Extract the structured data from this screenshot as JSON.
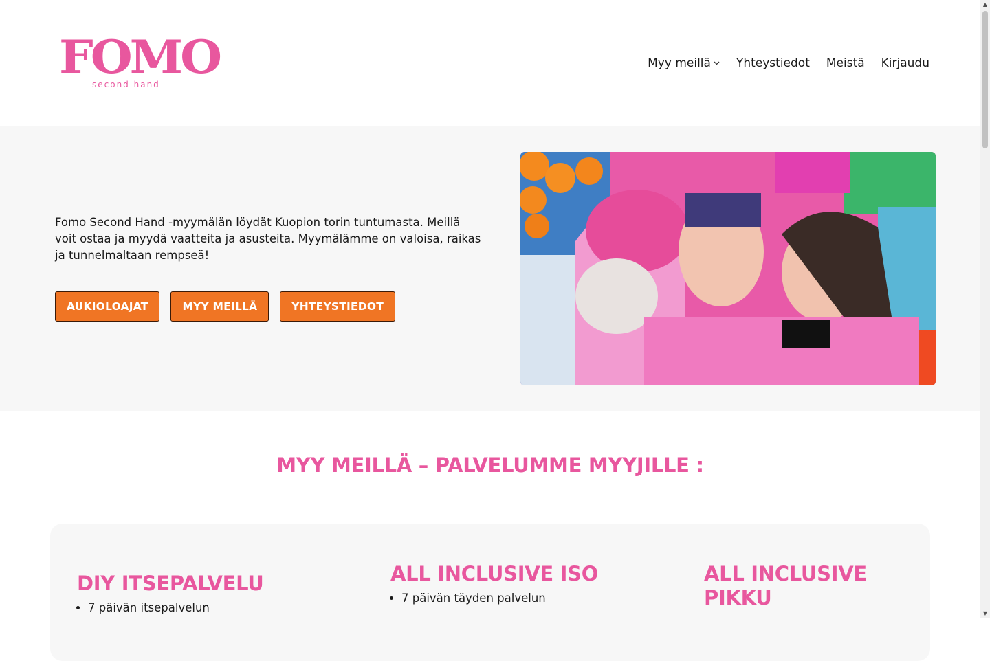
{
  "brand": {
    "name": "FOMO",
    "tagline": "second hand",
    "color": "#e8579e"
  },
  "nav": [
    {
      "label": "Myy meillä",
      "dropdown": true
    },
    {
      "label": "Yhteystiedot"
    },
    {
      "label": "Meistä"
    },
    {
      "label": "Kirjaudu"
    }
  ],
  "hero": {
    "text": "Fomo Second Hand -myymälän löydät Kuopion torin tuntumasta. Meillä voit ostaa ja myydä vaatteita ja asusteita. Myymälämme on valoisa, raikas ja tunnelmaltaan rempseä!",
    "buttons": [
      "AUKIOLOAJAT",
      "MYY MEILLÄ",
      "YHTEYSTIEDOT"
    ],
    "button_color": "#f07524"
  },
  "section": {
    "title": "MYY MEILLÄ – PALVELUMME MYYJILLE :",
    "columns": [
      {
        "title": "DIY ITSEPALVELU",
        "items": [
          "7 päivän itsepalvelun"
        ]
      },
      {
        "title": "ALL INCLUSIVE ISO",
        "items": [
          "7 päivän täyden palvelun"
        ]
      },
      {
        "title": "ALL INCLUSIVE PIKKU",
        "items": []
      }
    ]
  }
}
